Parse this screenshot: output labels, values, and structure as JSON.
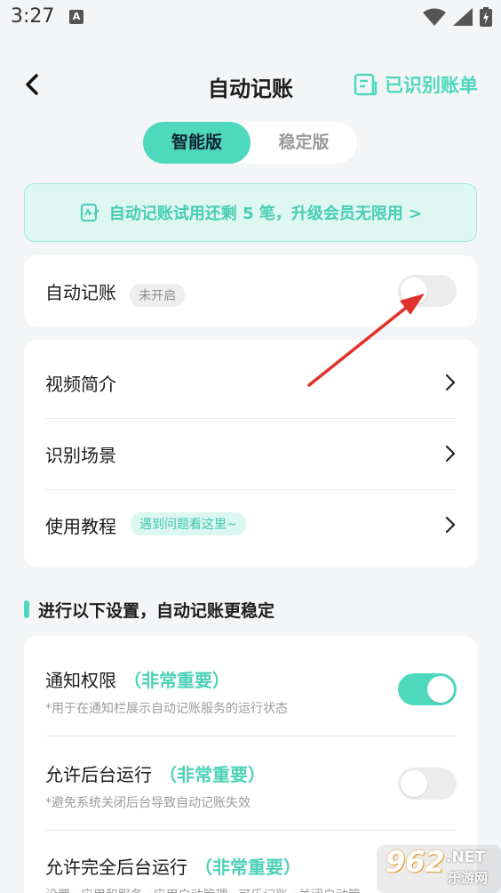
{
  "status": {
    "time": "3:27",
    "a_icon": "A"
  },
  "header": {
    "title": "自动记账",
    "bills_label": "已识别账单"
  },
  "tabs": [
    {
      "label": "智能版",
      "active": true
    },
    {
      "label": "稳定版",
      "active": false
    }
  ],
  "banner": {
    "text": "自动记账试用还剩 5 笔，升级会员无限用 >"
  },
  "auto_card": {
    "label": "自动记账",
    "badge": "未开启",
    "enabled": false
  },
  "menu": [
    {
      "label": "视频简介",
      "tag": ""
    },
    {
      "label": "识别场景",
      "tag": ""
    },
    {
      "label": "使用教程",
      "tag": "遇到问题看这里~"
    }
  ],
  "section": {
    "title": "进行以下设置，自动记账更稳定"
  },
  "settings": [
    {
      "title": "通知权限",
      "importance": "（非常重要）",
      "desc": "*用于在通知栏展示自动记账服务的运行状态",
      "enabled": true
    },
    {
      "title": "允许后台运行",
      "importance": "（非常重要）",
      "desc": "*避免系统关闭后台导致自动记账失效",
      "enabled": false
    },
    {
      "title": "允许完全后台运行",
      "importance": "（非常重要）",
      "desc": "设置→应用和服务→应用启动管理→可乐记账→关闭自动管"
    }
  ],
  "watermark": {
    "brand": "962",
    "suffix": ".NET",
    "sub": "乐游网"
  },
  "colors": {
    "accent": "#4ed8bd",
    "accent_text": "#46cdb3",
    "background": "#f4f5f7",
    "arrow": "#e0322b"
  }
}
